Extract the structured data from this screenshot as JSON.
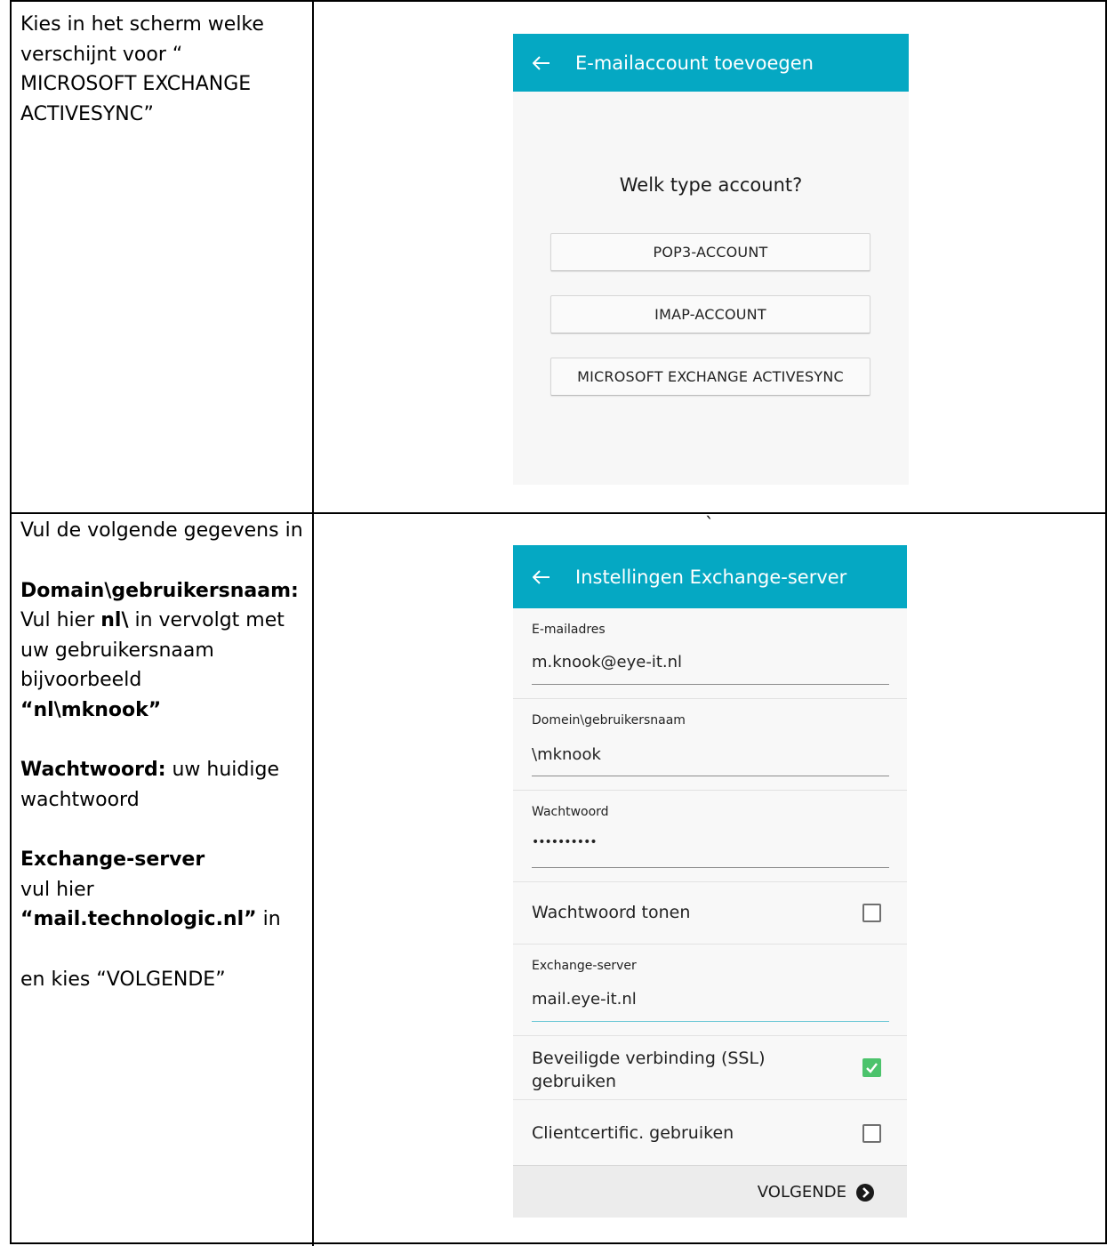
{
  "row1": {
    "instruction": "Kies in het scherm welke verschijnt voor “ MICROSOFT EXCHANGE ACTIVESYNC”",
    "phone": {
      "title": "E-mailaccount toevoegen",
      "question": "Welk type account?",
      "buttons": [
        "POP3-ACCOUNT",
        "IMAP-ACCOUNT",
        "MICROSOFT EXCHANGE ACTIVESYNC"
      ]
    }
  },
  "row2": {
    "instruction": {
      "intro": "Vul de volgende gegevens in",
      "domain_heading": "Domain\\gebruikersnaam:",
      "domain_text_1": "Vul hier ",
      "domain_bold": "nl\\",
      "domain_text_2": " in vervolgt met uw gebruikersnaam bijvoorbeeld",
      "domain_example": "“nl\\mknook”",
      "password_heading": "Wachtwoord:",
      "password_text": " uw huidige wachtwoord",
      "server_heading": "Exchange-server",
      "server_text": "vul hier",
      "server_value": "“mail.technologic.nl”",
      "server_suffix": " in",
      "next_text": "en kies “VOLGENDE”"
    },
    "backtick": "`",
    "phone": {
      "title": "Instellingen Exchange-server",
      "email_label": "E-mailadres",
      "email_value": "m.knook@eye-it.nl",
      "domain_label": "Domein\\gebruikersnaam",
      "domain_value": "\\mknook",
      "password_label": "Wachtwoord",
      "password_value": "••••••••••",
      "show_password_label": "Wachtwoord tonen",
      "show_password_checked": false,
      "server_label": "Exchange-server",
      "server_value": "mail.eye-it.nl",
      "ssl_label_1": "Beveiligde verbinding (SSL)",
      "ssl_label_2": "gebruiken",
      "ssl_checked": true,
      "client_cert_label": "Clientcertific. gebruiken",
      "client_cert_checked": false,
      "next_label": "VOLGENDE"
    }
  },
  "colors": {
    "appbar": "#05a8c3",
    "checkbox_checked": "#4cc36c"
  }
}
